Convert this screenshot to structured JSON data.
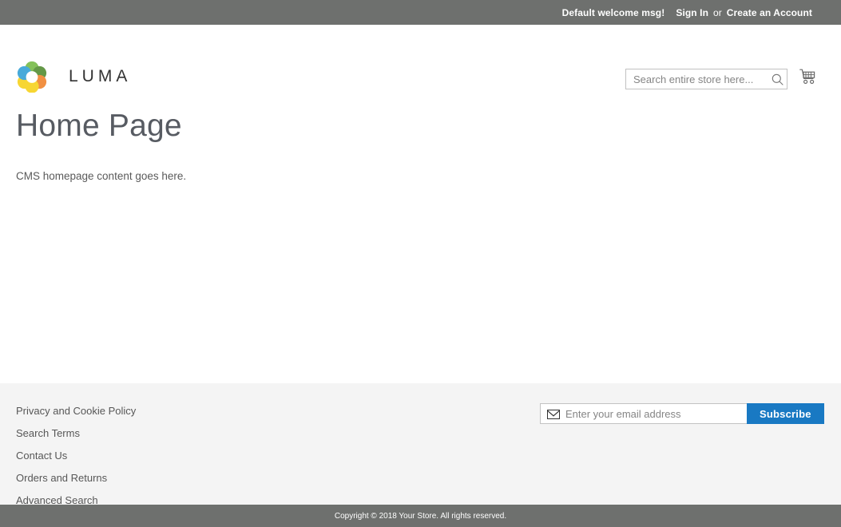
{
  "panel": {
    "greeting": "Default welcome msg!",
    "sign_in": "Sign In",
    "separator": "or",
    "create_account": "Create an Account"
  },
  "header": {
    "logo_text": "LUMA",
    "logo_icon": "luma-ring-logo",
    "search": {
      "placeholder": "Search entire store here...",
      "value": "",
      "icon": "search-icon"
    },
    "cart": {
      "icon": "shopping-cart-icon",
      "count": ""
    }
  },
  "main": {
    "page_title": "Home Page",
    "cms_text_before": "CMS homepage content goes ",
    "cms_link": "here",
    "cms_text_after": "."
  },
  "footer": {
    "links": [
      {
        "label": "Privacy and Cookie Policy"
      },
      {
        "label": "Search Terms"
      },
      {
        "label": "Contact Us"
      },
      {
        "label": "Orders and Returns"
      },
      {
        "label": "Advanced Search"
      }
    ],
    "newsletter": {
      "icon": "envelope-icon",
      "placeholder": "Enter your email address",
      "value": "",
      "subscribe_label": "Subscribe"
    },
    "copyright": "Copyright © 2018 Your Store. All rights reserved."
  },
  "colors": {
    "panel_bg": "#6e706e",
    "footer_bg": "#f4f4f4",
    "accent_blue": "#1979c3",
    "title_gray": "#575b62",
    "logo_blue": "#2f9fd5",
    "logo_green": "#74b943",
    "logo_dark_green": "#4f8a2e",
    "logo_yellow": "#f6d117",
    "logo_orange": "#f08128"
  }
}
